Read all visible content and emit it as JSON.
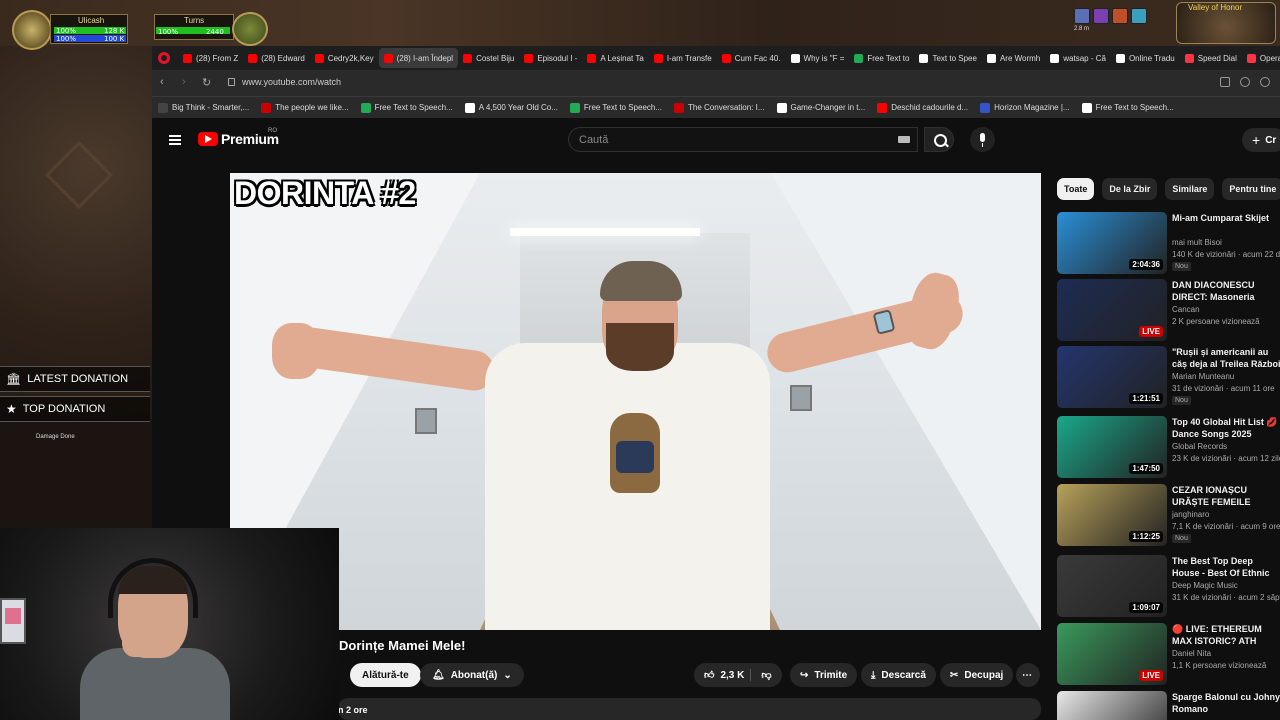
{
  "game": {
    "player_name": "Ulicash",
    "player_health": "100%",
    "player_health_value": "128 K",
    "player_mana": "100%",
    "player_mana_value": "100 K",
    "pet_name": "Turns",
    "pet_health": "100%",
    "pet_value": "2440",
    "zone_name": "Valley of Honor",
    "buff_time": "2.8 m",
    "damage_label": "Damage Done"
  },
  "overlay": {
    "latest_donation": "LATEST DONATION",
    "top_donation": "TOP DONATION"
  },
  "browser": {
    "tabs": [
      {
        "label": "(28) From Z",
        "color": "#ff0000"
      },
      {
        "label": "(28) Edward",
        "color": "#ff0000"
      },
      {
        "label": "Cedry2k,Key",
        "color": "#ff0000"
      },
      {
        "label": "(28) I-am Îndepl",
        "color": "#ff0000",
        "active": true
      },
      {
        "label": "Costel Biju",
        "color": "#ff0000"
      },
      {
        "label": "Episodul I -",
        "color": "#ff0000"
      },
      {
        "label": "A Leșinat Ta",
        "color": "#ff0000"
      },
      {
        "label": "I-am Transfe",
        "color": "#ff0000"
      },
      {
        "label": "Cum Fac 40.",
        "color": "#ff0000"
      },
      {
        "label": "Why is \"F =",
        "color": "#ffffff"
      },
      {
        "label": "Free Text to",
        "color": "#22aa55"
      },
      {
        "label": "Text to Spee",
        "color": "#ffffff"
      },
      {
        "label": "Are Wormh",
        "color": "#ffffff"
      },
      {
        "label": "watsap - Că",
        "color": "#ffffff"
      },
      {
        "label": "Online Tradu",
        "color": "#ffffff"
      },
      {
        "label": "Speed Dial",
        "color": "#ff3344"
      },
      {
        "label": "Opera | Upd",
        "color": "#ff3344"
      }
    ],
    "url": "www.youtube.com/watch",
    "bookmarks": [
      {
        "label": "Big Think - Smarter,...",
        "color": "#444444"
      },
      {
        "label": "The people we like...",
        "color": "#cc0000"
      },
      {
        "label": "Free Text to Speech...",
        "color": "#22aa55"
      },
      {
        "label": "A 4,500 Year Old Co...",
        "color": "#ffffff"
      },
      {
        "label": "Free Text to Speech...",
        "color": "#22aa55"
      },
      {
        "label": "The Conversation: I...",
        "color": "#cc0000"
      },
      {
        "label": "Game-Changer in t...",
        "color": "#ffffff"
      },
      {
        "label": "Deschid cadourile d...",
        "color": "#ff0000"
      },
      {
        "label": "Horizon Magazine |...",
        "color": "#3355cc"
      },
      {
        "label": "Free Text to Speech...",
        "color": "#ffffff"
      }
    ]
  },
  "youtube": {
    "logo_text": "Premium",
    "region": "RO",
    "search_placeholder": "Caută",
    "create_label": "Cr",
    "video_overlay_title": "DORINTA #2",
    "video_heading": "Dorințe Mamei Mele!",
    "join_label": "Alătură-te",
    "subscribed_label": "Abonat(ă)",
    "likes": "2,3 K",
    "share_label": "Trimite",
    "download_label": "Descarcă",
    "clip_label": "Decupaj",
    "meta_text": "n 2 ore",
    "chips": [
      "Toate",
      "De la Zbir",
      "Similare",
      "Pentru tine"
    ],
    "recommendations": [
      {
        "title": "Mi-am Cumparat Skijet",
        "channel": "mai mult Bisoi",
        "stats": "140 K de vizionări · acum 22 de",
        "duration": "2:04:36",
        "badge": "Nou",
        "thumb": "#2a8fd6"
      },
      {
        "title": "DAN DIACONESCU DIRECT: Masoneria conduce Româ",
        "channel": "Cancan",
        "stats": "2 K persoane vizionează",
        "live": "LIVE",
        "thumb": "#1d2c55"
      },
      {
        "title": "\"Rușii și americanii au căș deja al Treilea Război Mon",
        "channel": "Marian Munteanu",
        "stats": "31 de vizionări · acum 11 ore",
        "duration": "1:21:51",
        "badge": "Nou",
        "thumb": "#23356e"
      },
      {
        "title": "Top 40 Global Hit List 💋 Dance Songs 2025",
        "channel": "Global Records",
        "stats": "23 K de vizionări · acum 12 zile",
        "duration": "1:47:50",
        "thumb": "#1aa88a"
      },
      {
        "title": "CEZAR IONAȘCU URĂȘTE FEMEILE INDEPENDENTE",
        "channel": "janghinaro",
        "stats": "7,1 K de vizionări · acum 9 ore",
        "duration": "1:12:25",
        "badge": "Nou",
        "thumb": "#b7a15a"
      },
      {
        "title": "The Best Top Deep House - Best Of Ethnic Chill & Dee",
        "channel": "Deep Magic Music",
        "stats": "31 K de vizionări · acum 2 săpt",
        "duration": "1:09:07",
        "thumb": "#3a3a3a"
      },
      {
        "title": "🔴 LIVE: ETHEREUM MAX ISTORIC? ATH Watch Party",
        "channel": "Daniel Nita",
        "stats": "1,1 K persoane vizionează",
        "live": "LIVE",
        "thumb": "#3a9a5c"
      },
      {
        "title": "Sparge Balonul cu Johny Romano",
        "channel": "",
        "stats": "",
        "thumb": "#e8e8e8"
      }
    ]
  }
}
